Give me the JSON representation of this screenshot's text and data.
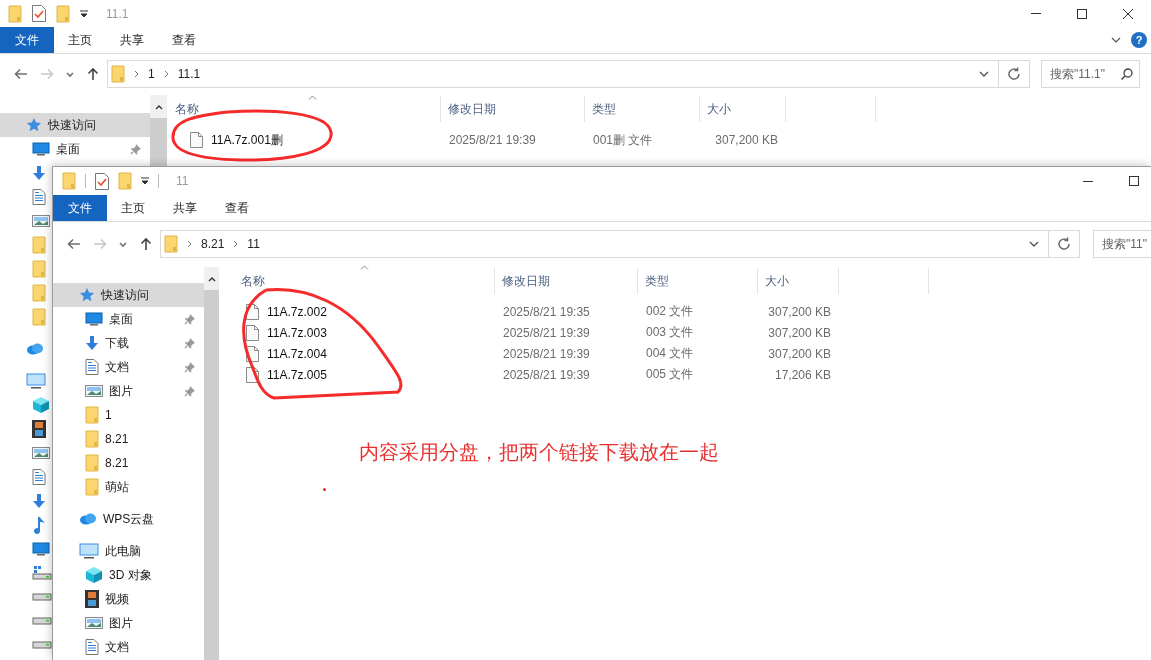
{
  "windows": [
    {
      "title": "11.1",
      "ribbon_tabs": [
        {
          "label": "文件",
          "kind": "file"
        },
        {
          "label": "主页",
          "kind": "tab"
        },
        {
          "label": "共享",
          "kind": "tab"
        },
        {
          "label": "查看",
          "kind": "tab"
        }
      ],
      "help_button": "?",
      "nav": [
        {
          "kind": "back",
          "disabled": false
        },
        {
          "kind": "forward",
          "disabled": true
        },
        {
          "kind": "recent",
          "disabled": false
        },
        {
          "kind": "up",
          "disabled": false
        }
      ],
      "path": [
        "1",
        "11.1"
      ],
      "search": {
        "placeholder": "搜索\"11.1\""
      },
      "sidebar": [
        {
          "label": "快速访问",
          "kind": "quick_access",
          "selected": true,
          "children": [
            {
              "label": "桌面",
              "kind": "desktop",
              "selected": false,
              "pinned": true
            },
            {
              "kind": "downloads",
              "selected": false
            },
            {
              "kind": "documents",
              "selected": false
            },
            {
              "kind": "pictures",
              "selected": false
            },
            {
              "kind": "folder",
              "selected": false
            },
            {
              "kind": "folder",
              "selected": false
            },
            {
              "kind": "folder",
              "selected": false
            },
            {
              "kind": "folder",
              "selected": false
            }
          ]
        },
        {
          "kind": "cloud_drive",
          "selected": false
        },
        {
          "kind": "this_pc",
          "selected": false,
          "children": [
            {
              "kind": "objects_3d",
              "selected": false
            },
            {
              "kind": "videos",
              "selected": false
            },
            {
              "kind": "pictures",
              "selected": false
            },
            {
              "kind": "documents",
              "selected": false
            },
            {
              "kind": "downloads",
              "selected": false
            },
            {
              "kind": "music",
              "selected": false
            },
            {
              "kind": "desktop",
              "selected": false
            },
            {
              "kind": "system_drive",
              "selected": false
            },
            {
              "kind": "drive",
              "selected": false
            },
            {
              "kind": "drive",
              "selected": false
            },
            {
              "kind": "drive",
              "selected": false
            }
          ]
        }
      ],
      "columns": [
        "名称",
        "修改日期",
        "类型",
        "大小"
      ],
      "files": [
        {
          "name": "11A.7z.001删",
          "date": "2025/8/21 19:39",
          "type": "001删 文件",
          "size": "307,200 KB"
        }
      ]
    },
    {
      "title": "11",
      "ribbon_tabs": [
        {
          "label": "文件",
          "kind": "file"
        },
        {
          "label": "主页",
          "kind": "tab"
        },
        {
          "label": "共享",
          "kind": "tab"
        },
        {
          "label": "查看",
          "kind": "tab"
        }
      ],
      "nav": [
        {
          "kind": "back",
          "disabled": false
        },
        {
          "kind": "forward",
          "disabled": true
        },
        {
          "kind": "recent",
          "disabled": false
        },
        {
          "kind": "up",
          "disabled": false
        }
      ],
      "path": [
        "8.21",
        "11"
      ],
      "search": {
        "placeholder": "搜索\"11\""
      },
      "sidebar": [
        {
          "label": "快速访问",
          "kind": "quick_access",
          "selected": true,
          "children": [
            {
              "label": "桌面",
              "kind": "desktop",
              "selected": false,
              "pinned": true
            },
            {
              "label": "下载",
              "kind": "downloads",
              "selected": false,
              "pinned": true
            },
            {
              "label": "文档",
              "kind": "documents",
              "selected": false,
              "pinned": true
            },
            {
              "label": "图片",
              "kind": "pictures",
              "selected": false,
              "pinned": true
            },
            {
              "label": "1",
              "kind": "folder",
              "selected": false,
              "pinned": false
            },
            {
              "label": "8.21",
              "kind": "folder",
              "selected": false,
              "pinned": false
            },
            {
              "label": "8.21",
              "kind": "folder",
              "selected": false,
              "pinned": false
            },
            {
              "label": "萌站",
              "kind": "folder",
              "selected": false,
              "pinned": false
            }
          ]
        },
        {
          "label": "WPS云盘",
          "kind": "cloud_drive",
          "selected": false
        },
        {
          "label": "此电脑",
          "kind": "this_pc",
          "selected": false,
          "children": [
            {
              "label": "3D 对象",
              "kind": "objects_3d",
              "selected": false
            },
            {
              "label": "视频",
              "kind": "videos",
              "selected": false
            },
            {
              "label": "图片",
              "kind": "pictures",
              "selected": false
            },
            {
              "label": "文档",
              "kind": "documents",
              "selected": false
            }
          ]
        }
      ],
      "columns": [
        "名称",
        "修改日期",
        "类型",
        "大小"
      ],
      "files": [
        {
          "name": "11A.7z.002",
          "date": "2025/8/21 19:35",
          "type": "002 文件",
          "size": "307,200 KB"
        },
        {
          "name": "11A.7z.003",
          "date": "2025/8/21 19:39",
          "type": "003 文件",
          "size": "307,200 KB"
        },
        {
          "name": "11A.7z.004",
          "date": "2025/8/21 19:39",
          "type": "004 文件",
          "size": "307,200 KB"
        },
        {
          "name": "11A.7z.005",
          "date": "2025/8/21 19:39",
          "type": "005 文件",
          "size": "17,206 KB"
        }
      ],
      "annotation": "内容采用分盘，把两个链接下载放在一起"
    }
  ]
}
